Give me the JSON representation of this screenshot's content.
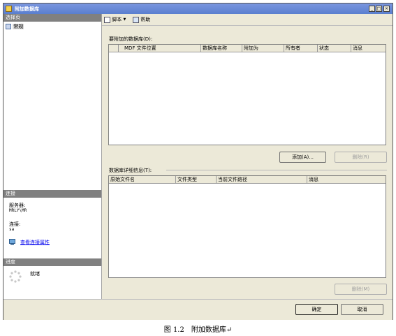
{
  "window": {
    "title": "附加数据库",
    "min": "_",
    "max": "□",
    "close": "×"
  },
  "sidebar": {
    "select_page_head": "选择页",
    "pages": [
      {
        "label": "常规"
      }
    ],
    "connection_head": "连接",
    "server_label": "服务器:",
    "server_value": "MRLY\\MR",
    "connection_label": "连接:",
    "connection_value": "sa",
    "view_props": "查看连接属性",
    "progress_head": "进度",
    "progress_status": "就绪"
  },
  "toolbar": {
    "script": "脚本",
    "help": "帮助"
  },
  "attach_section": {
    "label": "要附加的数据库(D):",
    "columns": [
      "MDF 文件位置",
      "数据库名称",
      "附加为",
      "所有者",
      "状态",
      "消息"
    ],
    "add_button": "添加(A)...",
    "remove_button": "删除(R)"
  },
  "details_section": {
    "label": "数据库详细信息(T):",
    "columns": [
      "原始文件名",
      "文件类型",
      "当前文件路径",
      "消息"
    ],
    "remove_button": "删除(M)"
  },
  "footer": {
    "ok": "确定",
    "cancel": "取消"
  },
  "caption": "图 1.2　附加数据库↵"
}
